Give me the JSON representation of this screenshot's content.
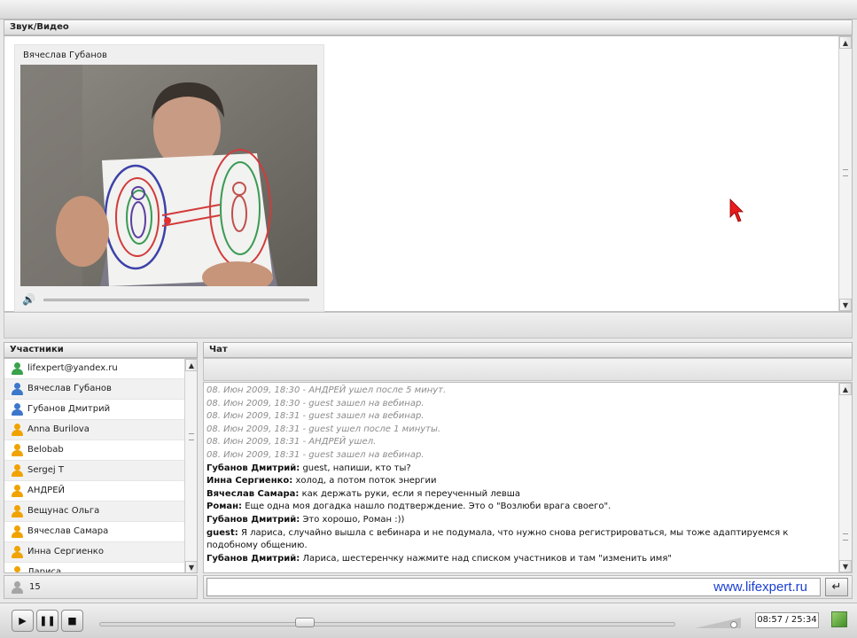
{
  "av_panel": {
    "title": "Звук/Видео"
  },
  "camera": {
    "name": "Вячеслав Губанов"
  },
  "participants": {
    "title": "Участники",
    "count": "15",
    "items": [
      {
        "name": "lifexpert@yandex.ru",
        "icon": "user-green-icon",
        "color": "green"
      },
      {
        "name": "Вячеслав Губанов",
        "icon": "user-blue-icon",
        "color": "blue"
      },
      {
        "name": "Губанов Дмитрий",
        "icon": "user-blue-icon",
        "color": "blue"
      },
      {
        "name": "Anna Burilova",
        "icon": "user-orange-icon",
        "color": "orange"
      },
      {
        "name": "Belobab",
        "icon": "user-orange-icon",
        "color": "orange"
      },
      {
        "name": "Sergej T",
        "icon": "user-orange-icon",
        "color": "orange"
      },
      {
        "name": "АНДРЕЙ",
        "icon": "user-orange-icon",
        "color": "orange"
      },
      {
        "name": "Вещунас Ольга",
        "icon": "user-orange-icon",
        "color": "orange"
      },
      {
        "name": "Вячеслав Самара",
        "icon": "user-orange-icon",
        "color": "orange"
      },
      {
        "name": "Инна Сергиенко",
        "icon": "user-orange-icon",
        "color": "orange"
      },
      {
        "name": "Лариса",
        "icon": "user-orange-icon",
        "color": "orange"
      }
    ]
  },
  "chat": {
    "title": "Чат",
    "messages": [
      {
        "type": "system",
        "text": "08. Июн 2009, 18:30 - АНДРЕЙ ушел после 5 минут."
      },
      {
        "type": "system",
        "text": "08. Июн 2009, 18:30 - guest зашел на вебинар."
      },
      {
        "type": "system",
        "text": "08. Июн 2009, 18:31 - guest зашел на вебинар."
      },
      {
        "type": "system",
        "text": "08. Июн 2009, 18:31 - guest ушел после 1 минуты."
      },
      {
        "type": "system",
        "text": "08. Июн 2009, 18:31 - АНДРЕЙ ушел."
      },
      {
        "type": "system",
        "text": "08. Июн 2009, 18:31 - guest зашел на вебинар."
      },
      {
        "type": "message",
        "author": "Губанов Дмитрий:",
        "text": " guest, напиши, кто ты?"
      },
      {
        "type": "message",
        "author": "Инна Сергиенко:",
        "text": " холод, а потом поток энергии"
      },
      {
        "type": "message",
        "author": "Вячеслав Самара:",
        "text": " как держать руки, если я переученный левша"
      },
      {
        "type": "message",
        "author": "Роман:",
        "text": " Еще одна моя догадка нашло подтверждение. Это о \"Возлюби врага своего\"."
      },
      {
        "type": "message",
        "author": "Губанов Дмитрий:",
        "text": " Это хорошо, Роман :))"
      },
      {
        "type": "message",
        "author": "guest:",
        "text": " Я лариса, случайно вышла с вебинара и не подумала, что нужно снова регистрироваться, мы тоже адаптируемся к подобному общению."
      },
      {
        "type": "message",
        "author": "Губанов Дмитрий:",
        "text": " Лариса, шестеренчку нажмите над списком участников и там \"изменить имя\""
      }
    ],
    "input_value": "",
    "watermark": "www.lifexpert.ru"
  },
  "player": {
    "time": "08:57 / 25:34",
    "progress": 0.35,
    "volume": 0.9
  }
}
